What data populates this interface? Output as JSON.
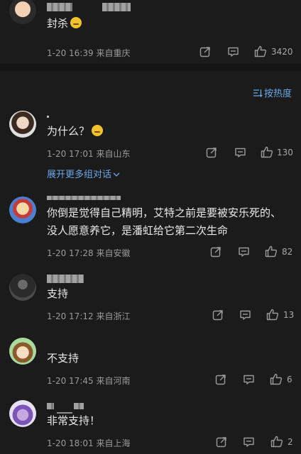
{
  "top_comment": {
    "text": "封杀",
    "meta": "1-20 16:39  来自重庆",
    "likes": "3420"
  },
  "sort": {
    "label": "按热度"
  },
  "comments": [
    {
      "text": "为什么？",
      "meta": "1-20 17:01  来自山东",
      "likes": "130",
      "expand": "展开更多组对话"
    },
    {
      "text_lines": [
        "你倒是觉得自己精明，艾特之前是要被安乐死的、",
        "没人愿意养它，是潘虹给它第二次生命"
      ],
      "meta": "1-20 17:28  来自安徽",
      "likes": "82"
    },
    {
      "text": "支持",
      "meta": "1-20 17:12  来自浙江",
      "likes": "13"
    },
    {
      "text": "不支持",
      "meta": "1-20 17:45  来自河南",
      "likes": "6"
    },
    {
      "text": "非常支持！",
      "meta": "1-20 18:01  来自上海",
      "likes": "2"
    }
  ]
}
